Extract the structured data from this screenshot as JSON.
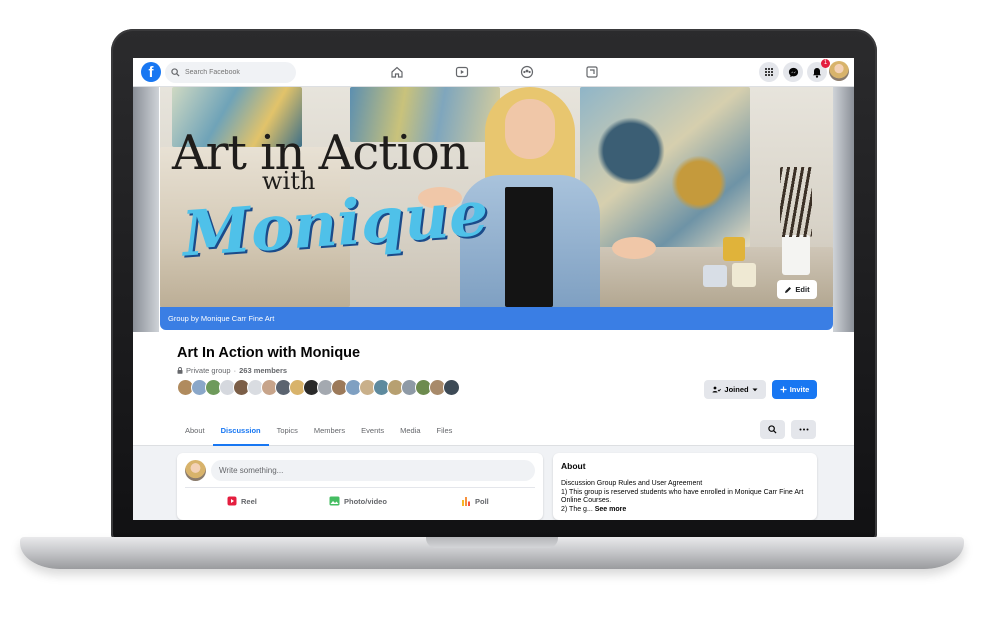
{
  "topnav": {
    "logo": "f",
    "search_placeholder": "Search Facebook",
    "notification_count": "1",
    "icons": [
      "home-icon",
      "watch-icon",
      "groups-icon",
      "gaming-icon",
      "menu-grid-icon",
      "messenger-icon",
      "bell-icon"
    ]
  },
  "cover": {
    "title_line1": "Art in Action",
    "title_line2": "with",
    "script_name": "Monique",
    "edit_label": "Edit",
    "caption": "Group by Monique Carr Fine Art"
  },
  "group": {
    "name": "Art In Action with Monique",
    "privacy": "Private group",
    "separator": "·",
    "members": "263 members",
    "joined_label": "Joined",
    "invite_label": "Invite"
  },
  "tabs": [
    {
      "label": "About"
    },
    {
      "label": "Discussion"
    },
    {
      "label": "Topics"
    },
    {
      "label": "Members"
    },
    {
      "label": "Events"
    },
    {
      "label": "Media"
    },
    {
      "label": "Files"
    }
  ],
  "active_tab": "Discussion",
  "composer": {
    "placeholder": "Write something...",
    "actions": [
      {
        "label": "Reel",
        "icon": "reel-icon"
      },
      {
        "label": "Photo/video",
        "icon": "photo-icon"
      },
      {
        "label": "Poll",
        "icon": "poll-icon"
      }
    ]
  },
  "about": {
    "title": "About",
    "line1": "Discussion Group Rules and User Agreement",
    "line2": "1) This group is reserved students who have enrolled in Monique Carr Fine Art Online Courses.",
    "line3": "2) The g...",
    "see_more": "See more"
  },
  "colors": {
    "facebook_blue": "#1877f2",
    "caption_blue": "#3a7ee4",
    "badge_red": "#e41e3f",
    "script_cyan": "#4fc1e9"
  }
}
